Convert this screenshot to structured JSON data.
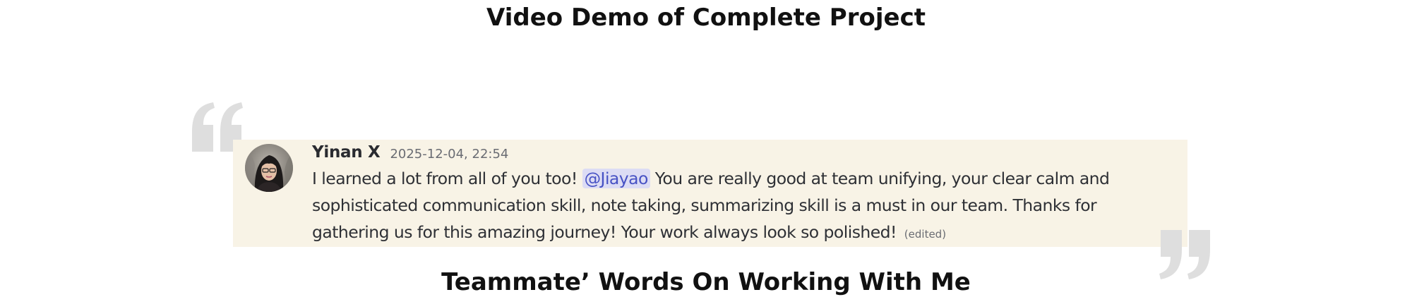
{
  "headings": {
    "top": "Video Demo of Complete Project",
    "bottom": "Teammate’ Words On Working With Me"
  },
  "quote_marks": {
    "color": "#dedede",
    "open_icon": "open-quote-icon",
    "close_icon": "close-quote-icon"
  },
  "message": {
    "background": "#f8f3e6",
    "author": "Yinan X",
    "timestamp": "2025-12-04, 22:54",
    "line1_before": "I learned a lot from all of you too! ",
    "mention": "@Jiayao",
    "line1_after": " You are really good at team unifying, your clear calm and",
    "line2": "sophisticated communication skill, note taking, summarizing skill is a must in our team. Thanks for",
    "line3": "gathering us for this amazing journey! Your work always look so polished!",
    "edited": "(edited)",
    "avatar_icon": "user-avatar"
  }
}
